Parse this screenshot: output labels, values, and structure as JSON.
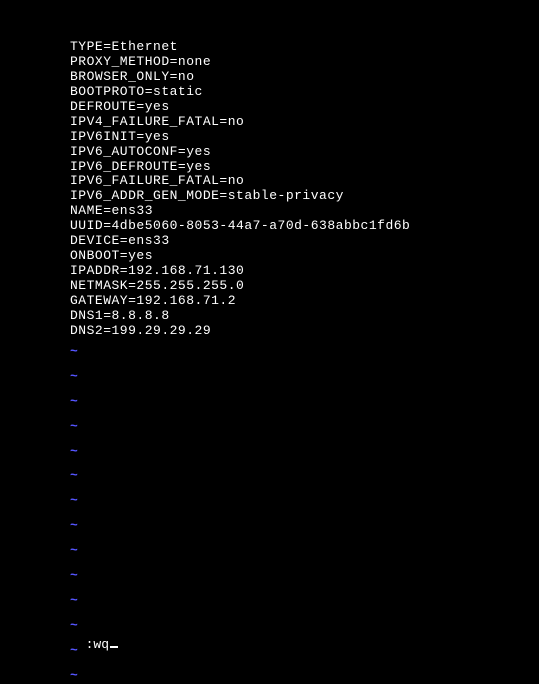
{
  "lines": [
    "TYPE=Ethernet",
    "PROXY_METHOD=none",
    "BROWSER_ONLY=no",
    "BOOTPROTO=static",
    "DEFROUTE=yes",
    "IPV4_FAILURE_FATAL=no",
    "IPV6INIT=yes",
    "IPV6_AUTOCONF=yes",
    "IPV6_DEFROUTE=yes",
    "IPV6_FAILURE_FATAL=no",
    "IPV6_ADDR_GEN_MODE=stable-privacy",
    "NAME=ens33",
    "UUID=4dbe5060-8053-44a7-a70d-638abbc1fd6b",
    "DEVICE=ens33",
    "ONBOOT=yes",
    "IPADDR=192.168.71.130",
    "NETMASK=255.255.255.0",
    "GATEWAY=192.168.71.2",
    "DNS1=8.8.8.8",
    "DNS2=199.29.29.29"
  ],
  "tilde": "~",
  "command": ":wq"
}
